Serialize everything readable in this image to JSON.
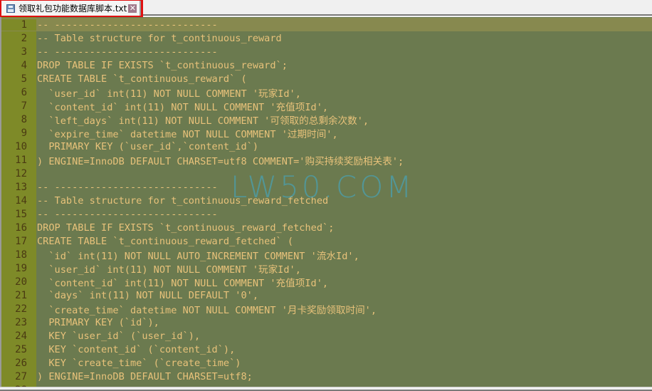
{
  "tab": {
    "title": "领取礼包功能数据库脚本.txt",
    "icon": "save-icon",
    "close_glyph": "✕"
  },
  "editor": {
    "current_line": 1,
    "lines": [
      "-- ----------------------------",
      "-- Table structure for t_continuous_reward",
      "-- ----------------------------",
      "DROP TABLE IF EXISTS `t_continuous_reward`;",
      "CREATE TABLE `t_continuous_reward` (",
      "  `user_id` int(11) NOT NULL COMMENT '玩家Id',",
      "  `content_id` int(11) NOT NULL COMMENT '充值项Id',",
      "  `left_days` int(11) NOT NULL COMMENT '可领取的总剩余次数',",
      "  `expire_time` datetime NOT NULL COMMENT '过期时间',",
      "  PRIMARY KEY (`user_id`,`content_id`)",
      ") ENGINE=InnoDB DEFAULT CHARSET=utf8 COMMENT='购买持续奖励相关表';",
      "",
      "-- ----------------------------",
      "-- Table structure for t_continuous_reward_fetched",
      "-- ----------------------------",
      "DROP TABLE IF EXISTS `t_continuous_reward_fetched`;",
      "CREATE TABLE `t_continuous_reward_fetched` (",
      "  `id` int(11) NOT NULL AUTO_INCREMENT COMMENT '流水Id',",
      "  `user_id` int(11) NOT NULL COMMENT '玩家Id',",
      "  `content_id` int(11) NOT NULL COMMENT '充值项Id',",
      "  `days` int(11) NOT NULL DEFAULT '0',",
      "  `create_time` datetime NOT NULL COMMENT '月卡奖励领取时间',",
      "  PRIMARY KEY (`id`),",
      "  KEY `user_id` (`user_id`),",
      "  KEY `content_id` (`content_id`),",
      "  KEY `create_time` (`create_time`)",
      ") ENGINE=InnoDB DEFAULT CHARSET=utf8;",
      ""
    ]
  },
  "watermark": "LW50.COM"
}
